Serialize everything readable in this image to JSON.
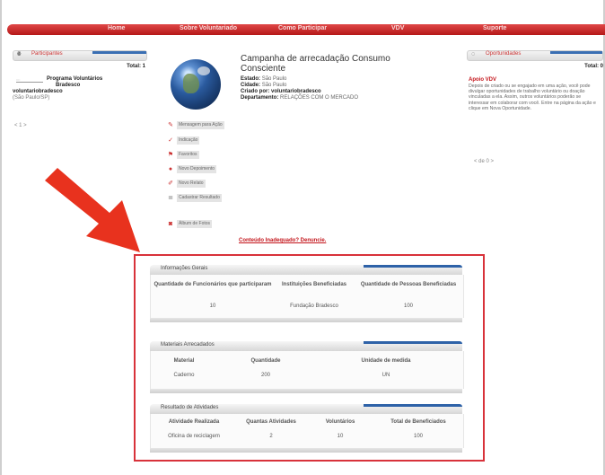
{
  "nav": {
    "items": [
      {
        "label": "Home"
      },
      {
        "label": "Sobre Voluntariado"
      },
      {
        "label": "Como Participar"
      },
      {
        "label": "VDV"
      },
      {
        "label": "Suporte"
      }
    ]
  },
  "participants": {
    "header": "Participantes",
    "total": "Total: 1",
    "program_line1": "Programa Voluntários",
    "program_line2": "Bradesco",
    "user": "voluntariobradesco",
    "location": "(São Paulo/SP)",
    "pager": "< 1 >"
  },
  "campaign": {
    "title": "Campanha de arrecadação Consumo Consciente",
    "state_label": "Estado:",
    "state_value": "São Paulo",
    "city_label": "Cidade:",
    "city_value": "São Paulo",
    "creator_label": "Criado por:",
    "creator_value": "voluntariobradesco",
    "dept_label": "Departamento:",
    "dept_value": "RELAÇÕES COM O MERCADO"
  },
  "side_actions": [
    {
      "label": "Mensagem para Ação",
      "icon": "message-icon"
    },
    {
      "label": "Indicação",
      "icon": "check-icon"
    },
    {
      "label": "Favoritos",
      "icon": "flag-icon"
    },
    {
      "label": "Novo Depoimento",
      "icon": "pin-icon"
    },
    {
      "label": "Novo Relato",
      "icon": "pencil-icon"
    },
    {
      "label": "Cadastrar Resultado",
      "icon": "list-icon"
    },
    {
      "label": "Álbum de Fotos",
      "icon": "camera-icon"
    }
  ],
  "opportunities": {
    "header": "Oportunidades",
    "total": "Total: 0",
    "heading": "Apoio VDV",
    "text": "Depois de criado ou se engajado em uma ação, você pode divulgar oportunidades de trabalho voluntário ou doação vinculadas a ela. Assim, outros voluntários poderão se interessar em colaborar com você. Entre na página da ação e clique em Nova Oportunidade.",
    "pager": "< de 0 >"
  },
  "link": "Conteúdo Inadequado? Denuncie.",
  "general_info": {
    "title": "Informações Gerais",
    "columns": [
      "Quantidade de Funcionários que participaram",
      "Instituições Beneficiadas",
      "Quantidade de Pessoas Beneficiadas"
    ],
    "row": [
      "10",
      "Fundação Bradesco",
      "100"
    ]
  },
  "materials": {
    "title": "Materiais Arrecadados",
    "columns": [
      "Material",
      "Quantidade",
      "Unidade de medida"
    ],
    "row": [
      "Caderno",
      "200",
      "UN"
    ]
  },
  "results": {
    "title": "Resultado de Atividades",
    "columns": [
      "Atividade Realizada",
      "Quantas Atividades",
      "Voluntários",
      "Total de Beneficiados"
    ],
    "row": [
      "Oficina de reciclagem",
      "2",
      "10",
      "100"
    ]
  },
  "colors": {
    "accent": "#c3141a",
    "highlight": "#d8323a",
    "bar_blue": "#2e62a8"
  }
}
